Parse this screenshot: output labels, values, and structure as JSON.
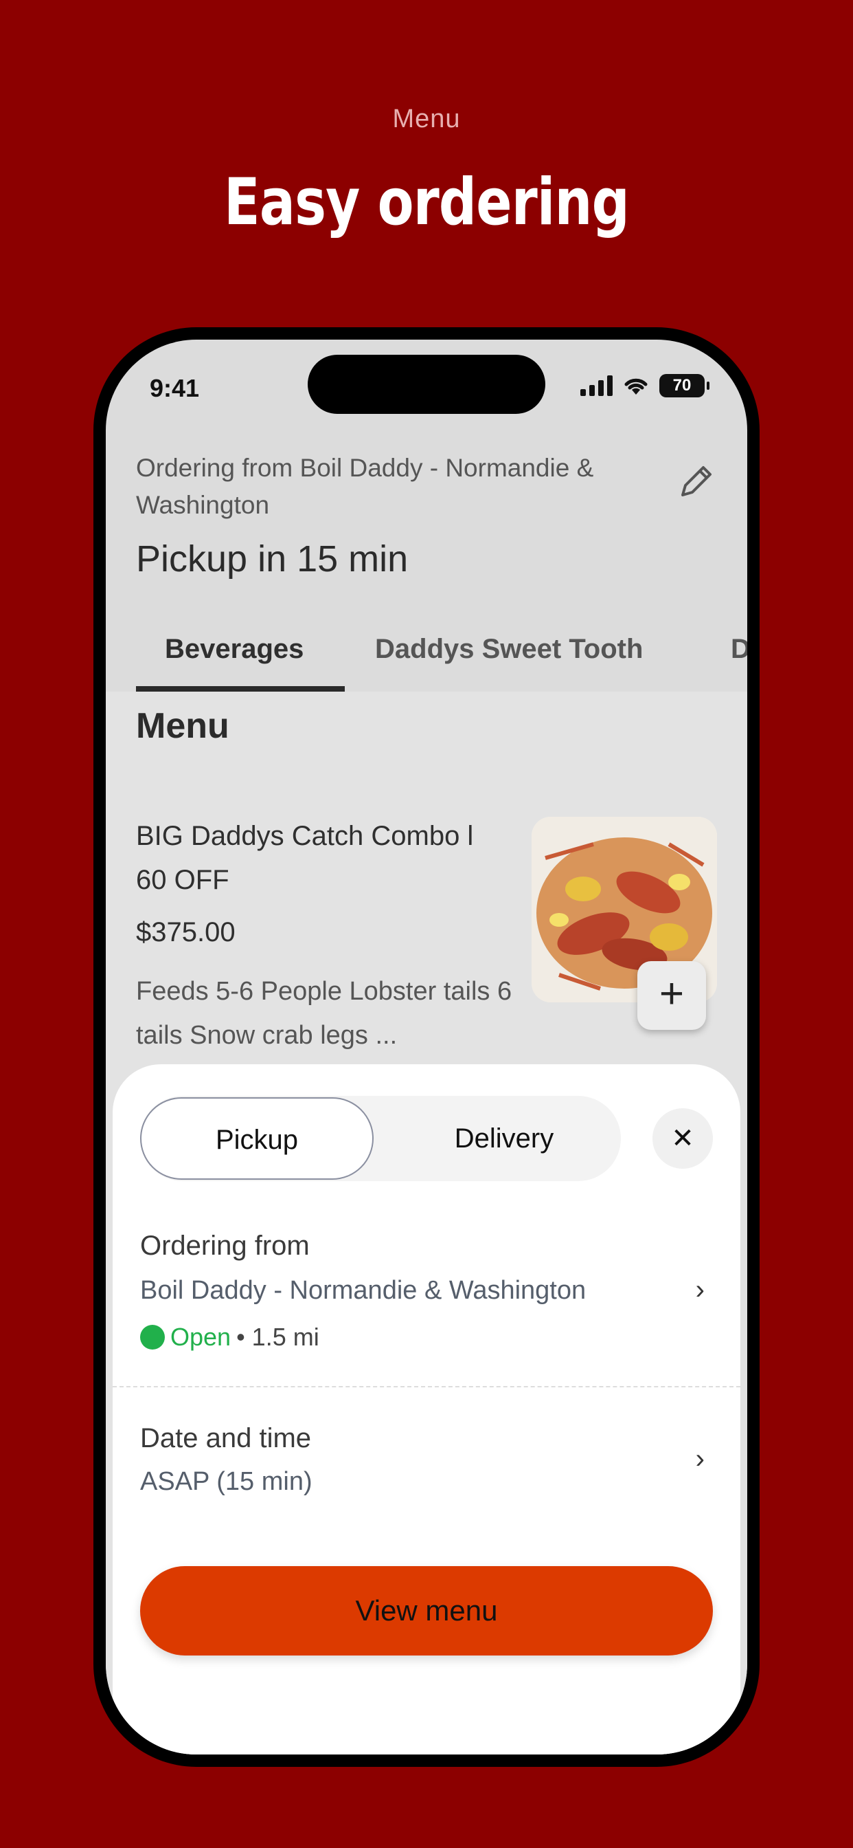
{
  "header": {
    "eyebrow": "Menu",
    "headline": "Easy ordering"
  },
  "status_bar": {
    "time": "9:41",
    "battery": "70"
  },
  "order_info": {
    "ordering_from": "Ordering from Boil Daddy - Normandie & Washington",
    "pickup_time": "Pickup in 15 min",
    "edit_icon": "pencil-icon"
  },
  "tabs": [
    {
      "label": "Beverages",
      "active": true
    },
    {
      "label": "Daddys Sweet Tooth",
      "active": false
    },
    {
      "label": "D",
      "active": false
    }
  ],
  "menu": {
    "title": "Menu",
    "item": {
      "name": "BIG Daddys Catch Combo l 60 OFF",
      "price": "$375.00",
      "description": "Feeds 5-6 People Lobster tails 6 tails Snow crab legs ...",
      "add_label": "+"
    }
  },
  "sheet": {
    "toggle": {
      "pickup": "Pickup",
      "delivery": "Delivery",
      "selected": "Pickup"
    },
    "close_label": "✕",
    "ordering_from_label": "Ordering from",
    "store_name": "Boil Daddy - Normandie & Washington",
    "open_status": "Open",
    "distance": "• 1.5 mi",
    "date_time_label": "Date and time",
    "date_time_value": "ASAP (15 min)",
    "cta": "View menu"
  },
  "colors": {
    "background": "#8c0000",
    "accent": "#dc3a00",
    "open_green": "#21b04b"
  }
}
